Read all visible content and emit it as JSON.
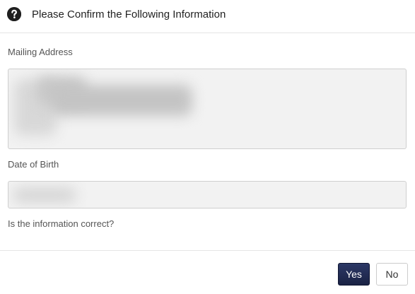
{
  "dialog": {
    "title": "Please Confirm the Following Information",
    "icon": "question-circle-icon"
  },
  "fields": {
    "mailing_address": {
      "label": "Mailing Address",
      "value": ""
    },
    "date_of_birth": {
      "label": "Date of Birth",
      "value": ""
    }
  },
  "question": "Is the information correct?",
  "buttons": {
    "yes_label": "Yes",
    "no_label": "No"
  },
  "colors": {
    "primary_button": "#1f2a4e",
    "field_background": "#f2f2f2"
  }
}
